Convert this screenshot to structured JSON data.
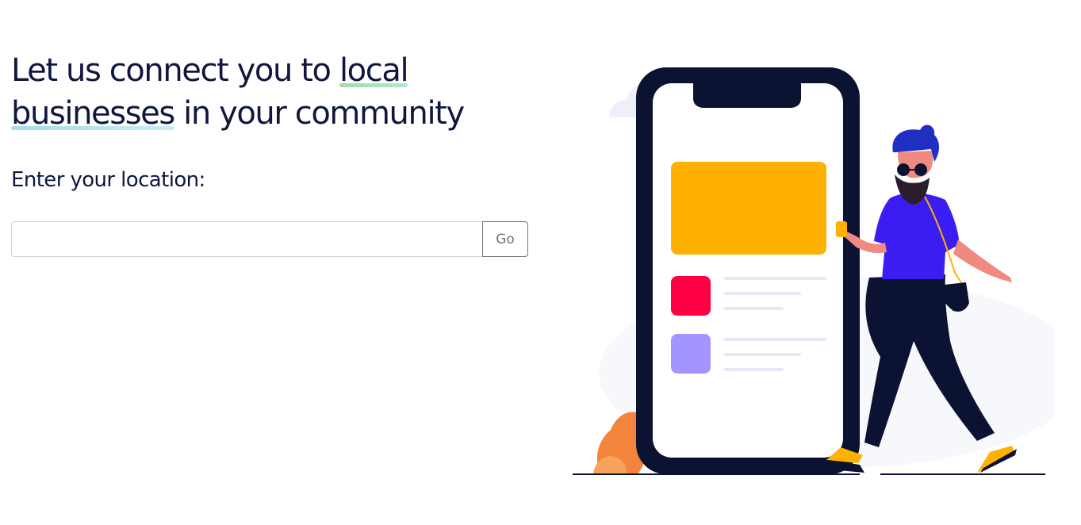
{
  "hero": {
    "headline_part1": "Let us connect you to ",
    "headline_highlight1": "local",
    "headline_highlight2": "businesses",
    "headline_part2": " in your community",
    "location_label": "Enter your location:",
    "location_input_value": "",
    "location_input_placeholder": "",
    "go_button_label": "Go"
  },
  "illustration": {
    "subject": "man-walking-with-phone-illustration",
    "colors": {
      "phone_frame": "#0c1232",
      "card_yellow": "#ffb102",
      "tile_red": "#ff0044",
      "tile_purple": "#a395ff",
      "shirt": "#3a1df2",
      "plant": "#f3843b",
      "line_gray": "#e6e8f5"
    }
  }
}
